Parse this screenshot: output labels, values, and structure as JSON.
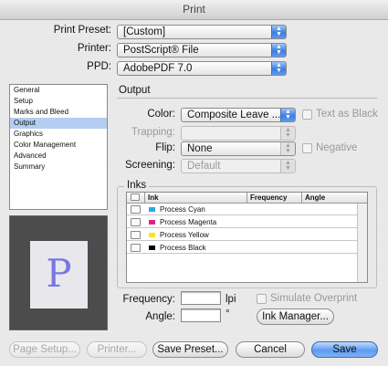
{
  "window": {
    "title": "Print"
  },
  "top": {
    "preset_label": "Print Preset:",
    "preset_value": "[Custom]",
    "printer_label": "Printer:",
    "printer_value": "PostScript® File",
    "ppd_label": "PPD:",
    "ppd_value": "AdobePDF 7.0"
  },
  "sidebar": {
    "items": [
      {
        "label": "General"
      },
      {
        "label": "Setup"
      },
      {
        "label": "Marks and Bleed"
      },
      {
        "label": "Output",
        "selected": true
      },
      {
        "label": "Graphics"
      },
      {
        "label": "Color Management"
      },
      {
        "label": "Advanced"
      },
      {
        "label": "Summary"
      }
    ]
  },
  "preview": {
    "glyph": "P"
  },
  "output": {
    "section_title": "Output",
    "color_label": "Color:",
    "color_value": "Composite Leave ...",
    "text_as_black_label": "Text as Black",
    "trapping_label": "Trapping:",
    "trapping_value": "",
    "flip_label": "Flip:",
    "flip_value": "None",
    "negative_label": "Negative",
    "screening_label": "Screening:",
    "screening_value": "Default"
  },
  "inks": {
    "section_title": "Inks",
    "columns": [
      "Ink",
      "Frequency",
      "Angle"
    ],
    "rows": [
      {
        "name": "Process Cyan",
        "color": "#29a9e8"
      },
      {
        "name": "Process Magenta",
        "color": "#e0208a"
      },
      {
        "name": "Process Yellow",
        "color": "#f5e51f"
      },
      {
        "name": "Process Black",
        "color": "#000000"
      }
    ],
    "frequency_label": "Frequency:",
    "frequency_unit": "lpi",
    "angle_label": "Angle:",
    "angle_unit": "°",
    "simulate_overprint_label": "Simulate Overprint",
    "ink_manager_label": "Ink Manager..."
  },
  "buttons": {
    "page_setup": "Page Setup...",
    "printer": "Printer...",
    "save_preset": "Save Preset...",
    "cancel": "Cancel",
    "save": "Save"
  }
}
